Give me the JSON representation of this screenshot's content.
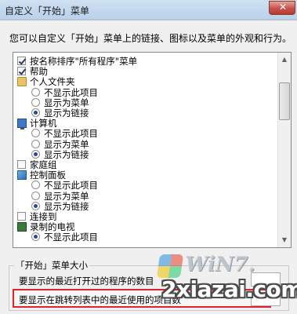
{
  "window": {
    "title": "自定义「开始」菜单",
    "close_symbol": "✕"
  },
  "intro": "您可以自定义「开始」菜单上的链接、图标以及菜单的外观和行为。",
  "list": {
    "items": [
      {
        "kind": "checkbox",
        "checked": true,
        "label": "按名称排序\"所有程序\"菜单"
      },
      {
        "kind": "checkbox",
        "checked": true,
        "label": "帮助"
      },
      {
        "kind": "header",
        "icon": "folder-icon",
        "label": "个人文件夹"
      },
      {
        "kind": "radio",
        "checked": false,
        "label": "不显示此项目"
      },
      {
        "kind": "radio",
        "checked": false,
        "label": "显示为菜单"
      },
      {
        "kind": "radio",
        "checked": true,
        "label": "显示为链接"
      },
      {
        "kind": "header",
        "icon": "computer-icon",
        "label": "计算机"
      },
      {
        "kind": "radio",
        "checked": false,
        "label": "不显示此项目"
      },
      {
        "kind": "radio",
        "checked": false,
        "label": "显示为菜单"
      },
      {
        "kind": "radio",
        "checked": true,
        "label": "显示为链接"
      },
      {
        "kind": "checkbox",
        "checked": false,
        "label": "家庭组"
      },
      {
        "kind": "header",
        "icon": "control-panel-icon",
        "label": "控制面板"
      },
      {
        "kind": "radio",
        "checked": false,
        "label": "不显示此项目"
      },
      {
        "kind": "radio",
        "checked": false,
        "label": "显示为菜单"
      },
      {
        "kind": "radio",
        "checked": true,
        "label": "显示为链接"
      },
      {
        "kind": "checkbox",
        "checked": false,
        "label": "连接到"
      },
      {
        "kind": "header",
        "icon": "tv-icon",
        "label": "录制的电视"
      },
      {
        "kind": "radio",
        "checked": true,
        "label": "不显示此项目"
      }
    ]
  },
  "menu_size": {
    "group_label": "「开始」菜单大小",
    "recent_programs_label": "要显示的最近打开过的程序的数目",
    "recent_programs_value": "",
    "jump_list_label": "要显示在跳转列表中的最近使用的项目数",
    "jump_list_value": ""
  },
  "watermark": {
    "logo_text": "WiN7.",
    "site": "2xiazai.com"
  },
  "colors": {
    "highlight_box": "#e0242a",
    "title_bar": "#b9d1ea"
  }
}
